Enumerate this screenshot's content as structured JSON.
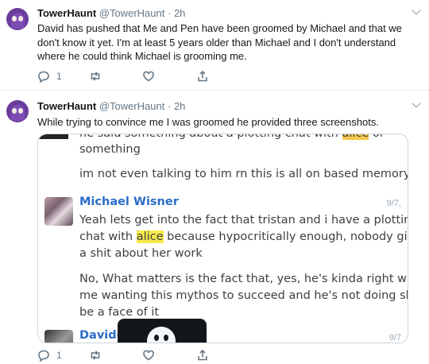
{
  "tweets": [
    {
      "author": "TowerHaunt",
      "handle": "@TowerHaunt",
      "separator": "·",
      "time": "2h",
      "text": "David has pushed that Me and Pen have been groomed by Michael and that we don't know it yet. I'm at least 5 years older than Michael and I don't understand where he could think Michael is grooming me.",
      "reply_count": "1",
      "retweet_count": "",
      "like_count": ""
    },
    {
      "author": "TowerHaunt",
      "handle": "@TowerHaunt",
      "separator": "·",
      "time": "2h",
      "text": "While trying to convince me I was groomed he provided three screenshots.",
      "reply_count": "1",
      "retweet_count": "",
      "like_count": ""
    }
  ],
  "screenshot": {
    "cut_line_pre": "he said something about a plotting chat with",
    "cut_line_highlight": "alice",
    "cut_line_post": "or",
    "line_something": "something",
    "line_memory": "im not even talking to him rn this is all on based memory",
    "author": "Michael Wisner",
    "timestamp": "9/7,",
    "msg1_pre": "Yeah lets get into the fact that tristan and i have a plotting",
    "msg1_line2_pre": "chat with",
    "msg1_highlight": "alice",
    "msg1_line2_post": "because hypocritically enough, nobody gives",
    "msg1_line3": "a shit about her work",
    "msg2_line1": "No, What matters is the fact that, yes, he's kinda right with",
    "msg2_line2": "me wanting this mythos to succeed and he's not doing shit to",
    "msg2_line3": "be a face of it",
    "next_author": "David-",
    "next_timestamp": "9/7"
  },
  "icons": [
    "reply-icon",
    "retweet-icon",
    "like-icon",
    "share-icon",
    "caret-down-icon"
  ],
  "colors": {
    "mention_blue": "#2b6ec7",
    "highlight": "#f7e94a",
    "avatar_purple": "#6a3c9c"
  }
}
